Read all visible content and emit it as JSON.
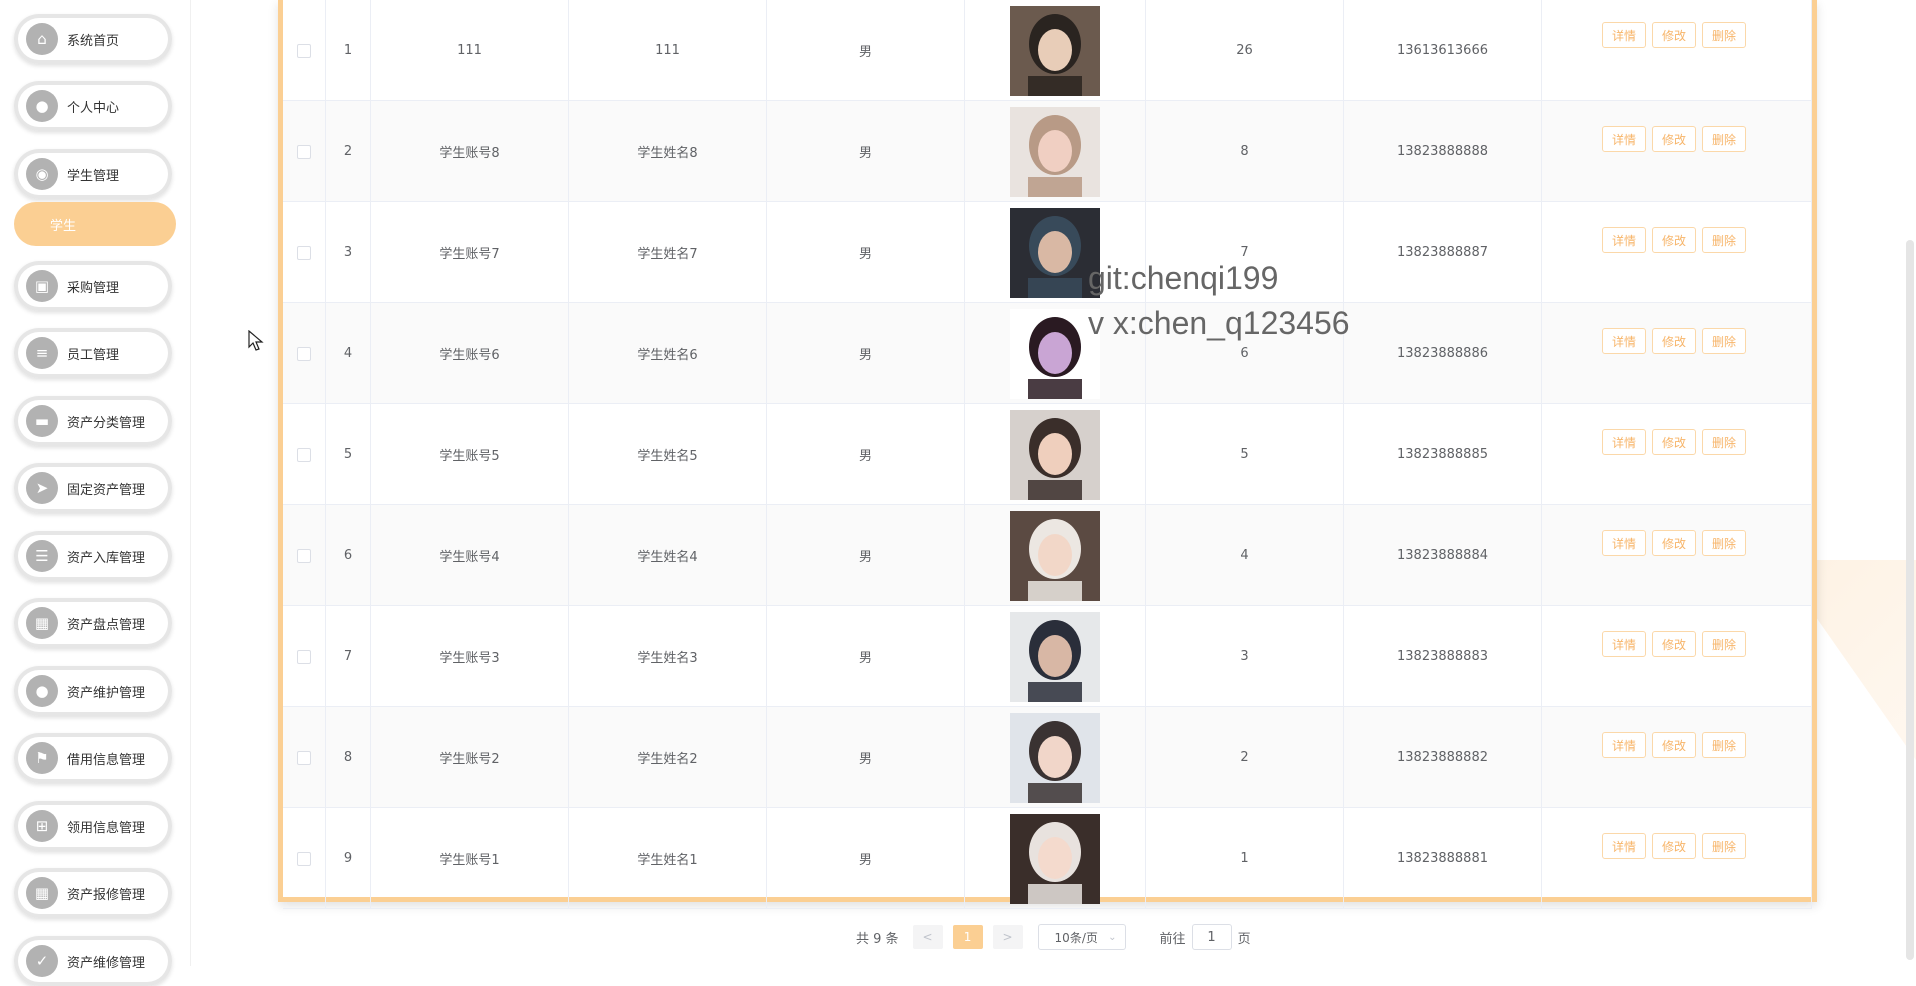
{
  "sidebar": {
    "items": [
      {
        "label": "系统首页",
        "icon": "home-icon"
      },
      {
        "label": "个人中心",
        "icon": "user-icon"
      },
      {
        "label": "学生管理",
        "icon": "location-icon"
      },
      {
        "label": "采购管理",
        "icon": "briefcase-icon"
      },
      {
        "label": "员工管理",
        "icon": "list-icon"
      },
      {
        "label": "资产分类管理",
        "icon": "monitor-icon"
      },
      {
        "label": "固定资产管理",
        "icon": "send-icon"
      },
      {
        "label": "资产入库管理",
        "icon": "sliders-icon"
      },
      {
        "label": "资产盘点管理",
        "icon": "grid-icon"
      },
      {
        "label": "资产维护管理",
        "icon": "user-icon"
      },
      {
        "label": "借用信息管理",
        "icon": "flag-icon"
      },
      {
        "label": "领用信息管理",
        "icon": "apps-icon"
      },
      {
        "label": "资产报修管理",
        "icon": "grid-icon"
      },
      {
        "label": "资产维修管理",
        "icon": "check-icon"
      }
    ],
    "active_sub": "学生"
  },
  "table": {
    "rows": [
      {
        "idx": "1",
        "account": "111",
        "name": "111",
        "gender": "男",
        "age": "26",
        "phone": "13613613666"
      },
      {
        "idx": "2",
        "account": "学生账号8",
        "name": "学生姓名8",
        "gender": "男",
        "age": "8",
        "phone": "13823888888"
      },
      {
        "idx": "3",
        "account": "学生账号7",
        "name": "学生姓名7",
        "gender": "男",
        "age": "7",
        "phone": "13823888887"
      },
      {
        "idx": "4",
        "account": "学生账号6",
        "name": "学生姓名6",
        "gender": "男",
        "age": "6",
        "phone": "13823888886"
      },
      {
        "idx": "5",
        "account": "学生账号5",
        "name": "学生姓名5",
        "gender": "男",
        "age": "5",
        "phone": "13823888885"
      },
      {
        "idx": "6",
        "account": "学生账号4",
        "name": "学生姓名4",
        "gender": "男",
        "age": "4",
        "phone": "13823888884"
      },
      {
        "idx": "7",
        "account": "学生账号3",
        "name": "学生姓名3",
        "gender": "男",
        "age": "3",
        "phone": "13823888883"
      },
      {
        "idx": "8",
        "account": "学生账号2",
        "name": "学生姓名2",
        "gender": "男",
        "age": "2",
        "phone": "13823888882"
      },
      {
        "idx": "9",
        "account": "学生账号1",
        "name": "学生姓名1",
        "gender": "男",
        "age": "1",
        "phone": "13823888881"
      }
    ],
    "actions": {
      "detail": "详情",
      "edit": "修改",
      "delete": "删除"
    }
  },
  "watermark": {
    "line1": "git:chenqi199",
    "line2": "v x:chen_q123456"
  },
  "pagination": {
    "total": "共 9 条",
    "prev": "<",
    "page": "1",
    "next": ">",
    "page_size": "10条/页",
    "goto_label": "前往",
    "goto_value": "1",
    "goto_suffix": "页"
  },
  "colors": {
    "accent": "#fbcf93",
    "button_text": "#f7b56a"
  }
}
